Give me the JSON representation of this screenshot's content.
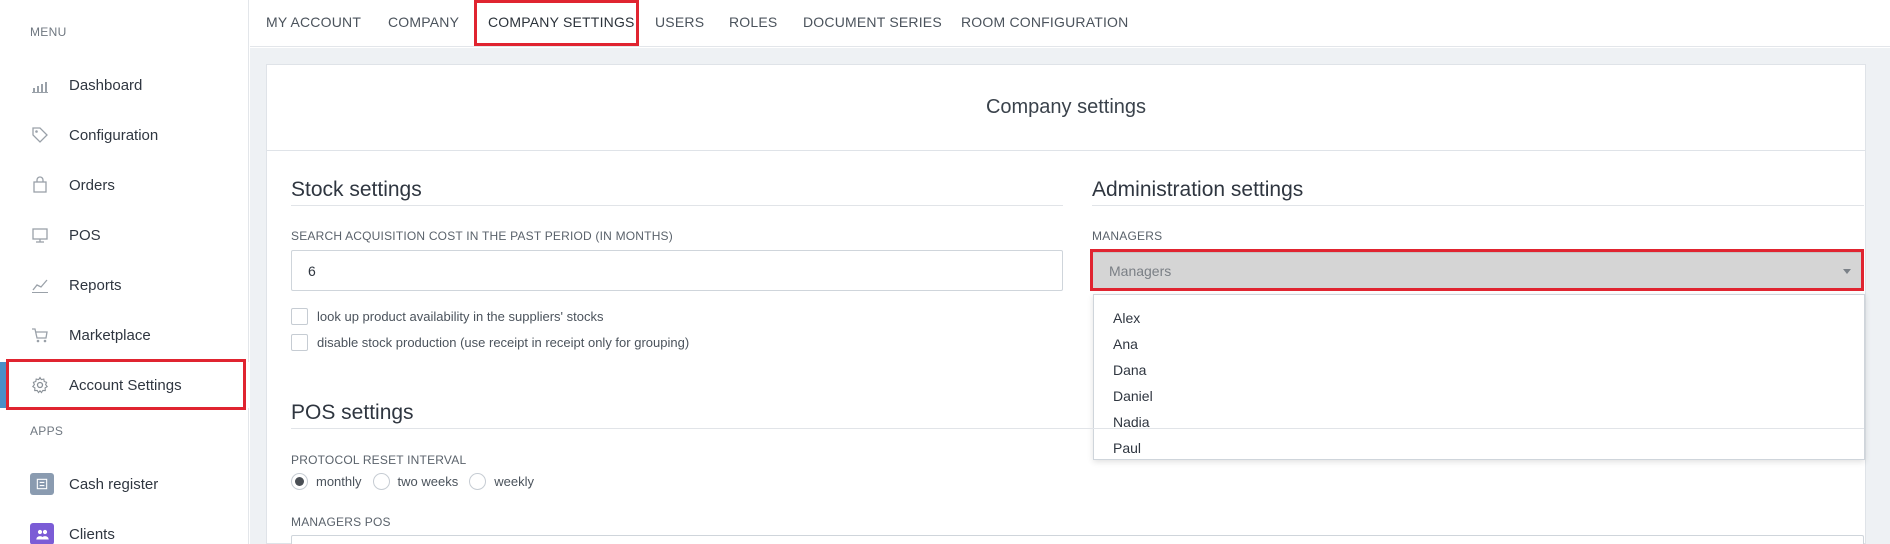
{
  "sidebar": {
    "menu_heading": "MENU",
    "apps_heading": "APPS",
    "items": [
      {
        "label": "Dashboard",
        "icon": "bar-chart-icon"
      },
      {
        "label": "Configuration",
        "icon": "tag-icon"
      },
      {
        "label": "Orders",
        "icon": "shopping-bag-icon"
      },
      {
        "label": "POS",
        "icon": "monitor-icon"
      },
      {
        "label": "Reports",
        "icon": "line-chart-icon"
      },
      {
        "label": "Marketplace",
        "icon": "cart-icon"
      },
      {
        "label": "Account Settings",
        "icon": "gear-icon",
        "active": true
      }
    ],
    "apps": [
      {
        "label": "Cash register",
        "icon": "cash-register-icon",
        "color": "#8a9bb0"
      },
      {
        "label": "Clients",
        "icon": "users-icon",
        "color": "#7b5cd6"
      }
    ]
  },
  "tabs": [
    {
      "label": "MY ACCOUNT"
    },
    {
      "label": "COMPANY"
    },
    {
      "label": "COMPANY SETTINGS",
      "active": true
    },
    {
      "label": "USERS"
    },
    {
      "label": "ROLES"
    },
    {
      "label": "DOCUMENT SERIES"
    },
    {
      "label": "ROOM CONFIGURATION"
    }
  ],
  "card": {
    "title": "Company settings"
  },
  "stock": {
    "title": "Stock settings",
    "acq_label": "SEARCH ACQUISITION COST IN THE PAST PERIOD (IN MONTHS)",
    "acq_value": "6",
    "checkbox1": "look up product availability in the suppliers' stocks",
    "checkbox2": "disable stock production (use receipt in receipt only for grouping)"
  },
  "admin": {
    "title": "Administration settings",
    "managers_label": "MANAGERS",
    "managers_placeholder": "Managers",
    "options": [
      "Alex",
      "Ana",
      "Dana",
      "Daniel",
      "Nadia",
      "Paul"
    ]
  },
  "pos": {
    "title": "POS settings",
    "interval_label": "PROTOCOL RESET INTERVAL",
    "interval_options": [
      "monthly",
      "two weeks",
      "weekly"
    ],
    "interval_selected": "monthly",
    "managers_pos_label": "MANAGERS POS"
  },
  "colors": {
    "highlight": "#e02430",
    "active_bar": "#4a90c8"
  }
}
